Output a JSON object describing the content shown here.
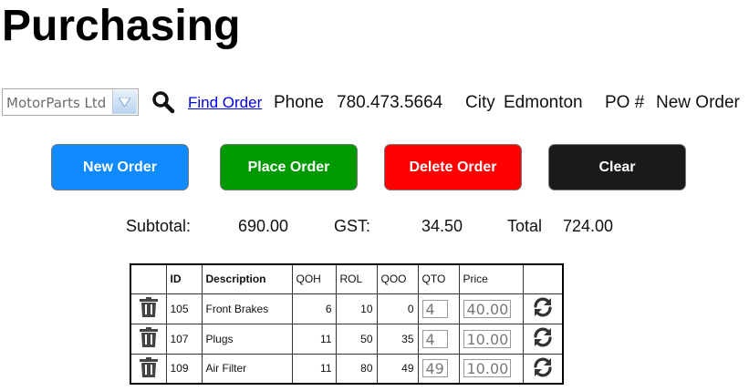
{
  "page": {
    "title": "Purchasing"
  },
  "toolbar": {
    "vendor": "MotorParts Ltd",
    "find_order": "Find Order",
    "phone_label": "Phone",
    "phone_value": "780.473.5664",
    "city_label": "City",
    "city_value": "Edmonton",
    "po_label": "PO #",
    "po_value": "New Order"
  },
  "buttons": {
    "new_order": "New Order",
    "place_order": "Place Order",
    "delete_order": "Delete Order",
    "clear": "Clear"
  },
  "totals": {
    "subtotal_label": "Subtotal:",
    "subtotal_value": "690.00",
    "gst_label": "GST:",
    "gst_value": "34.50",
    "total_label": "Total",
    "total_value": "724.00"
  },
  "table": {
    "headers": [
      "",
      "ID",
      "Description",
      "QOH",
      "ROL",
      "QOO",
      "QTO",
      "Price",
      ""
    ],
    "rows": [
      {
        "id": "105",
        "description": "Front Brakes",
        "qoh": "6",
        "rol": "10",
        "qoo": "0",
        "qto": "4",
        "price": "40.00"
      },
      {
        "id": "107",
        "description": "Plugs",
        "qoh": "11",
        "rol": "50",
        "qoo": "35",
        "qto": "4",
        "price": "10.00"
      },
      {
        "id": "109",
        "description": "Air Filter",
        "qoh": "11",
        "rol": "80",
        "qoo": "49",
        "qto": "49",
        "price": "10.00"
      }
    ]
  },
  "colors": {
    "new_order": "#0f8aff",
    "place_order": "#009900",
    "delete_order": "#ff0000",
    "clear": "#1a1a1a",
    "link": "#0000ee"
  },
  "icons": {
    "search": "search-icon",
    "delete_row": "trash-icon",
    "refresh_row": "refresh-icon"
  }
}
